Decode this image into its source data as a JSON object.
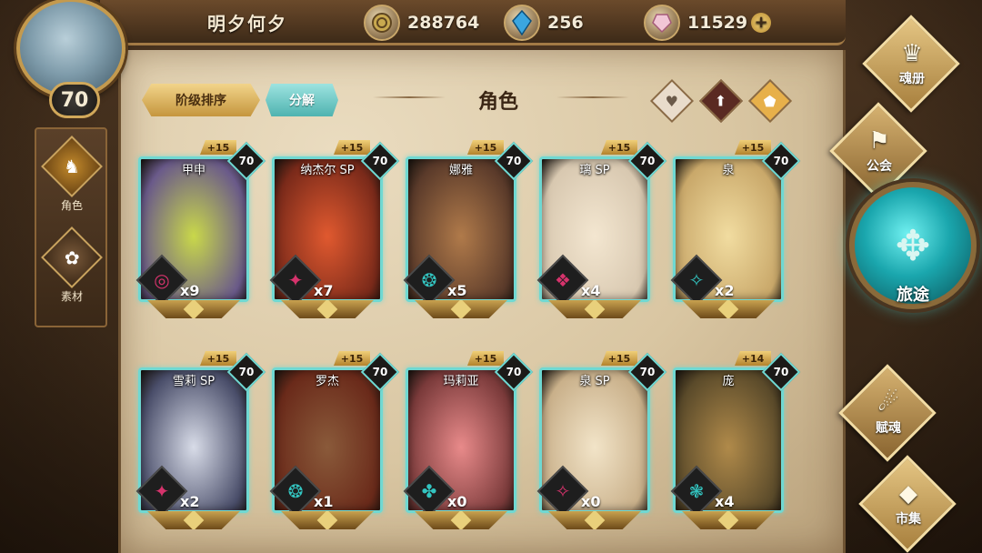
{
  "player": {
    "name": "明夕何夕",
    "level": "70"
  },
  "currencies": [
    {
      "icon": "coin-icon",
      "value": "288764"
    },
    {
      "icon": "blue-crystal-icon",
      "value": "256"
    },
    {
      "icon": "pink-gem-icon",
      "value": "11529"
    }
  ],
  "left_nav": [
    {
      "label": "角色",
      "icon": "helmet-icon",
      "active": true
    },
    {
      "label": "素材",
      "icon": "material-icon",
      "active": false
    }
  ],
  "toolbar": {
    "sort_label": "阶级排序",
    "decompose_label": "分解",
    "title": "角色"
  },
  "filters": [
    {
      "icon": "heart-icon",
      "glyph": "♥",
      "color": "#6b5a4a"
    },
    {
      "icon": "sword-icon",
      "glyph": "⬆",
      "color": "#ffffff"
    },
    {
      "icon": "shield-icon",
      "glyph": "⬟",
      "color": "#ffffff"
    }
  ],
  "cards": [
    {
      "name": "甲申",
      "star": "+15",
      "level": "70",
      "count": "x9",
      "elem": "◎",
      "elem_color": "#d6336c"
    },
    {
      "name": "纳杰尔 SP",
      "star": "+15",
      "level": "70",
      "count": "x7",
      "elem": "✦",
      "elem_color": "#d6336c"
    },
    {
      "name": "娜雅",
      "star": "+15",
      "level": "70",
      "count": "x5",
      "elem": "❂",
      "elem_color": "#33c4c0"
    },
    {
      "name": "璃 SP",
      "star": "+15",
      "level": "70",
      "count": "x4",
      "elem": "❖",
      "elem_color": "#d6336c"
    },
    {
      "name": "泉",
      "star": "+15",
      "level": "70",
      "count": "x2",
      "elem": "✧",
      "elem_color": "#33c4c0"
    },
    {
      "name": "雪莉 SP",
      "star": "+15",
      "level": "70",
      "count": "x2",
      "elem": "✦",
      "elem_color": "#d6336c"
    },
    {
      "name": "罗杰",
      "star": "+15",
      "level": "70",
      "count": "x1",
      "elem": "❂",
      "elem_color": "#33c4c0"
    },
    {
      "name": "玛莉亚",
      "star": "+15",
      "level": "70",
      "count": "x0",
      "elem": "✤",
      "elem_color": "#33c4c0"
    },
    {
      "name": "泉 SP",
      "star": "+15",
      "level": "70",
      "count": "x0",
      "elem": "✧",
      "elem_color": "#d6336c"
    },
    {
      "name": "庞",
      "star": "+14",
      "level": "70",
      "count": "x4",
      "elem": "❃",
      "elem_color": "#33c4c0"
    }
  ],
  "right_nav": [
    {
      "label": "魂册",
      "icon": "soul-book-icon",
      "glyph": "♛"
    },
    {
      "label": "公会",
      "icon": "guild-icon",
      "glyph": "⚑"
    },
    {
      "label": "赋魂",
      "icon": "spirit-icon",
      "glyph": "☄"
    },
    {
      "label": "市集",
      "icon": "market-icon",
      "glyph": "◆"
    }
  ],
  "journey": {
    "label": "旅途",
    "icon": "journey-emblem-icon"
  }
}
